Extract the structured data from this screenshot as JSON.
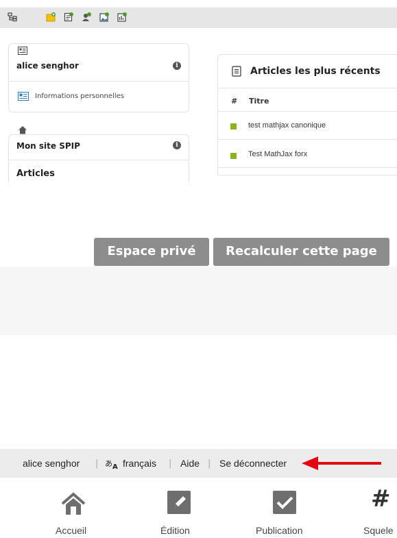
{
  "toolbar": {
    "icons": [
      "tree-icon",
      "new-folder-icon",
      "new-article-icon",
      "new-user-icon",
      "new-image-icon",
      "new-stats-icon"
    ]
  },
  "user_card": {
    "name": "alice senghor",
    "link_label": "Informations personnelles"
  },
  "site_card": {
    "title": "Mon site SPIP",
    "section": "Articles"
  },
  "articles": {
    "title": "Articles les plus récents",
    "col_hash": "#",
    "col_title": "Titre",
    "rows": [
      "test mathjax canonique",
      "Test MathJax forx"
    ],
    "status_color": "#8db31c"
  },
  "preview": {
    "private_space": "Espace privé",
    "recalc": "Recalculer cette page"
  },
  "footer": {
    "user": "alice senghor",
    "language": "français",
    "help": "Aide",
    "logout": "Se déconnecter"
  },
  "nav": {
    "home": "Accueil",
    "edition": "Édition",
    "publication": "Publication",
    "squelettes": "Squele"
  },
  "colors": {
    "arrow": "#e30613",
    "button": "#8d8d8d"
  }
}
